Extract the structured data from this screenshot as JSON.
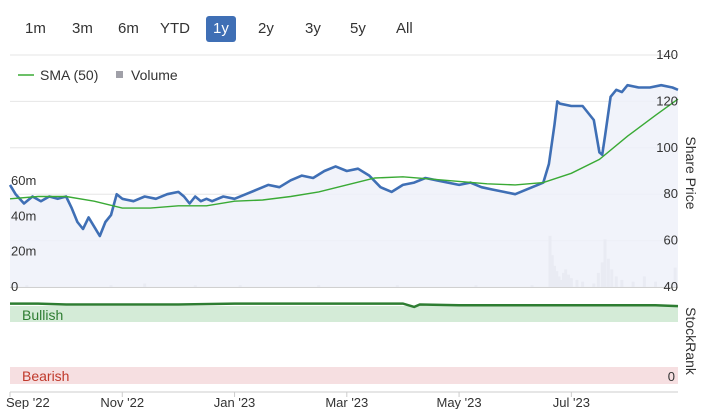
{
  "range_selector": {
    "options": [
      "1m",
      "3m",
      "6m",
      "YTD",
      "1y",
      "2y",
      "3y",
      "5y",
      "All"
    ],
    "active": "1y"
  },
  "colors": {
    "price_line": "#3f6fb5",
    "price_fill": "#eef1f9",
    "sma_line": "#3aaa35",
    "volume_bar": "#c9c9cf",
    "bullish_fill": "#d4ebd7",
    "bullish_text": "#2e7d32",
    "bearish_fill": "#f6dfe1",
    "bearish_text": "#c0392b",
    "stockrank_line": "#2e7d32",
    "active_button": "#3f6fb5"
  },
  "chart_data": {
    "type": "line",
    "legend": [
      "SMA (50)",
      "Volume"
    ],
    "legend_position": "top-left",
    "y_axis_title": "Share Price",
    "y_ticks": [
      "140",
      "120",
      "100",
      "80",
      "60",
      "40"
    ],
    "ylim": [
      40,
      140
    ],
    "volume_ticks": [
      "60m",
      "40m",
      "20m",
      "0"
    ],
    "volume_lim": [
      0,
      60
    ],
    "x_labels": [
      "Sep '22",
      "Nov '22",
      "Jan '23",
      "Mar '23",
      "May '23",
      "Jul '23"
    ],
    "x_label_months": [
      0,
      2,
      4,
      6,
      8,
      10
    ],
    "xlim_months": [
      0,
      11.9
    ],
    "grid": true,
    "price": {
      "x": [
        0,
        0.1,
        0.25,
        0.4,
        0.55,
        0.7,
        0.85,
        1.0,
        1.1,
        1.2,
        1.3,
        1.4,
        1.5,
        1.6,
        1.7,
        1.8,
        1.9,
        2.0,
        2.2,
        2.4,
        2.6,
        2.8,
        3.0,
        3.1,
        3.2,
        3.3,
        3.4,
        3.5,
        3.6,
        3.8,
        4.0,
        4.2,
        4.4,
        4.6,
        4.8,
        5.0,
        5.2,
        5.4,
        5.6,
        5.8,
        6.0,
        6.2,
        6.4,
        6.6,
        6.8,
        7.0,
        7.2,
        7.4,
        7.6,
        7.8,
        8.0,
        8.2,
        8.4,
        8.6,
        8.8,
        9.0,
        9.2,
        9.4,
        9.5,
        9.6,
        9.7,
        9.75,
        9.8,
        10.0,
        10.2,
        10.4,
        10.5,
        10.55,
        10.6,
        10.7,
        10.8,
        10.9,
        11.0,
        11.2,
        11.4,
        11.6,
        11.8,
        11.9
      ],
      "y": [
        84,
        80,
        76,
        79,
        77,
        79,
        78,
        79,
        74,
        68,
        65,
        70,
        66,
        62,
        68,
        71,
        80,
        78,
        77,
        79,
        78,
        80,
        81,
        79,
        76,
        79,
        77,
        78,
        77,
        79,
        78,
        80,
        82,
        84,
        83,
        86,
        88,
        87,
        90,
        92,
        90,
        91,
        88,
        83,
        81,
        84,
        85,
        87,
        86,
        85,
        84,
        85,
        83,
        82,
        81,
        80,
        82,
        84,
        85,
        93,
        110,
        120,
        119,
        118,
        118,
        112,
        98,
        97,
        105,
        122,
        125,
        124,
        127,
        126,
        126,
        127,
        126,
        125
      ]
    },
    "sma_50": {
      "x": [
        0,
        0.5,
        1,
        1.5,
        2,
        2.5,
        3,
        3.5,
        4,
        4.5,
        5,
        5.5,
        6,
        6.5,
        7,
        7.5,
        8,
        8.5,
        9,
        9.5,
        10,
        10.5,
        11,
        11.5,
        11.9
      ],
      "y": [
        78,
        79,
        79,
        77,
        74,
        74,
        75,
        75,
        77,
        77.5,
        79,
        81,
        84,
        87,
        87.5,
        86.5,
        85.5,
        84.5,
        84,
        85,
        89,
        95,
        105,
        114,
        121
      ]
    },
    "volume_m": {
      "x": [
        0.3,
        1.8,
        2.4,
        3.3,
        4.1,
        5.5,
        6.9,
        8.3,
        9.3,
        9.62,
        9.66,
        9.7,
        9.74,
        9.78,
        9.82,
        9.86,
        9.9,
        9.95,
        10.0,
        10.1,
        10.2,
        10.4,
        10.48,
        10.55,
        10.6,
        10.66,
        10.72,
        10.8,
        10.9,
        11.1,
        11.3,
        11.5,
        11.7,
        11.85
      ],
      "v": [
        1,
        1,
        2,
        1,
        1,
        1,
        1,
        1,
        1,
        29,
        18,
        12,
        9,
        6,
        4,
        8,
        10,
        7,
        5,
        4,
        3,
        2,
        8,
        14,
        27,
        16,
        10,
        6,
        4,
        3,
        6,
        3,
        2,
        11
      ]
    }
  },
  "stockrank": {
    "axis_title": "StockRank",
    "bullish_label": "Bullish",
    "bearish_label": "Bearish",
    "zero_label": "0",
    "x": [
      0,
      0.5,
      1,
      2,
      3,
      4,
      5,
      6,
      7,
      7.2,
      7.3,
      8,
      9,
      9.5,
      10,
      10.5,
      11,
      11.5,
      11.9
    ],
    "y": [
      98,
      98,
      97,
      97,
      97,
      98,
      98,
      98,
      98,
      94,
      97,
      96,
      96,
      96,
      96,
      96,
      96,
      96,
      95
    ]
  }
}
